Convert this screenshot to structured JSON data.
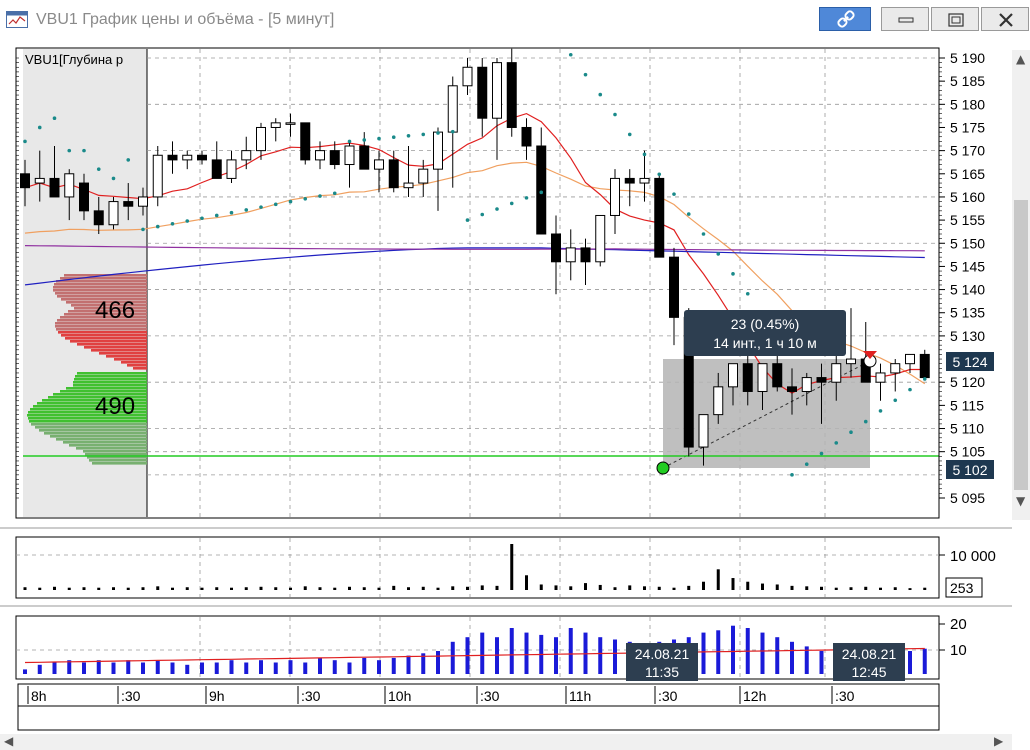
{
  "window": {
    "title": "VBU1 График цены и объёма - [5 минут]",
    "icon": "chart-window-icon",
    "buttons": {
      "link": "link-icon",
      "minimize": "minimize-icon",
      "maximize": "maximize-icon",
      "close": "close-icon"
    }
  },
  "price_panel": {
    "instrument_label": "VBU1[Глубина р",
    "price_ticks": [
      "5 190",
      "5 185",
      "5 180",
      "5 175",
      "5 170",
      "5 165",
      "5 160",
      "5 155",
      "5 150",
      "5 145",
      "5 140",
      "5 135",
      "5 130",
      "5 125",
      "5 120",
      "5 115",
      "5 110",
      "5 105",
      "5 100",
      "5 095"
    ],
    "last_price_tag": "5 124",
    "line_price_tag": "5 102",
    "profile_sell_label": "466",
    "profile_buy_label": "490",
    "tooltip_line1": "23 (0.45%)",
    "tooltip_line2": "14 инт., 1 ч 10 м",
    "colors": {
      "up": "#ffffff",
      "down": "#000000",
      "ma_fast": "#e02020",
      "ma_slow": "#f0a060",
      "ma_blue": "#2020c0",
      "ma_purple": "#9030a0",
      "parabolic": "#1a8a8a",
      "level_line": "#22cc22"
    }
  },
  "volume_panel": {
    "tick_label": "10 000",
    "current_value": "253"
  },
  "indicator_panel": {
    "tick_labels": [
      "20",
      "10"
    ],
    "cursor_left_date": "24.08.21",
    "cursor_left_time": "11:35",
    "cursor_right_date": "24.08.21",
    "cursor_right_time": "12:45"
  },
  "time_axis": {
    "labels": [
      "8h",
      ":30",
      "9h",
      ":30",
      "10h",
      ":30",
      "11h",
      ":30",
      "12h",
      ":30"
    ]
  },
  "chart_data": {
    "type": "candlestick",
    "price_axis": {
      "min": 5095,
      "max": 5190
    },
    "candles": [
      [
        5165,
        5168,
        5158,
        5162
      ],
      [
        5163,
        5170,
        5159,
        5164
      ],
      [
        5164,
        5171,
        5160,
        5160
      ],
      [
        5160,
        5166,
        5155,
        5165
      ],
      [
        5163,
        5165,
        5155,
        5157
      ],
      [
        5157,
        5160,
        5152,
        5154
      ],
      [
        5154,
        5160,
        5153,
        5159
      ],
      [
        5159,
        5163,
        5155,
        5158
      ],
      [
        5158,
        5162,
        5156,
        5160
      ],
      [
        5160,
        5171,
        5158,
        5169
      ],
      [
        5169,
        5172,
        5165,
        5168
      ],
      [
        5168,
        5170,
        5166,
        5169
      ],
      [
        5169,
        5170,
        5167,
        5168
      ],
      [
        5168,
        5172,
        5164,
        5164
      ],
      [
        5164,
        5170,
        5163,
        5168
      ],
      [
        5168,
        5173,
        5166,
        5170
      ],
      [
        5170,
        5176,
        5168,
        5175
      ],
      [
        5175,
        5177,
        5172,
        5176
      ],
      [
        5176,
        5178,
        5173,
        5176
      ],
      [
        5176,
        5176,
        5167,
        5168
      ],
      [
        5168,
        5172,
        5166,
        5170
      ],
      [
        5170,
        5172,
        5166,
        5167
      ],
      [
        5167,
        5172,
        5162,
        5171
      ],
      [
        5171,
        5174,
        5166,
        5166
      ],
      [
        5166,
        5170,
        5161,
        5168
      ],
      [
        5168,
        5170,
        5161,
        5162
      ],
      [
        5162,
        5171,
        5160,
        5163
      ],
      [
        5163,
        5168,
        5160,
        5166
      ],
      [
        5166,
        5175,
        5157,
        5174
      ],
      [
        5174,
        5186,
        5162,
        5184
      ],
      [
        5184,
        5190,
        5182,
        5188
      ],
      [
        5188,
        5190,
        5173,
        5177
      ],
      [
        5177,
        5190,
        5168,
        5189
      ],
      [
        5189,
        5192,
        5173,
        5175
      ],
      [
        5175,
        5177,
        5168,
        5171
      ],
      [
        5171,
        5175,
        5152,
        5152
      ],
      [
        5152,
        5156,
        5139,
        5146
      ],
      [
        5146,
        5153,
        5142,
        5149
      ],
      [
        5149,
        5151,
        5141,
        5146
      ],
      [
        5146,
        5153,
        5145,
        5156
      ],
      [
        5156,
        5166,
        5152,
        5164
      ],
      [
        5164,
        5166,
        5158,
        5163
      ],
      [
        5163,
        5170,
        5159,
        5164
      ],
      [
        5164,
        5165,
        5148,
        5147
      ],
      [
        5147,
        5149,
        5128,
        5134
      ],
      [
        5134,
        5136,
        5104,
        5106
      ],
      [
        5106,
        5112,
        5102,
        5113
      ],
      [
        5113,
        5122,
        5111,
        5119
      ],
      [
        5119,
        5124,
        5115,
        5124
      ],
      [
        5124,
        5128,
        5115,
        5118
      ],
      [
        5118,
        5124,
        5114,
        5124
      ],
      [
        5124,
        5126,
        5118,
        5119
      ],
      [
        5119,
        5123,
        5113,
        5118
      ],
      [
        5118,
        5122,
        5115,
        5121
      ],
      [
        5121,
        5124,
        5111,
        5120
      ],
      [
        5120,
        5126,
        5116,
        5124
      ],
      [
        5124,
        5136,
        5121,
        5125
      ],
      [
        5125,
        5133,
        5120,
        5120
      ],
      [
        5120,
        5124,
        5116,
        5122
      ],
      [
        5122,
        5125,
        5118,
        5124
      ],
      [
        5124,
        5126,
        5122,
        5126
      ],
      [
        5126,
        5127,
        5121,
        5121
      ]
    ],
    "volume": [
      6,
      5,
      7,
      5,
      6,
      5,
      6,
      5,
      6,
      8,
      5,
      6,
      5,
      6,
      5,
      6,
      7,
      6,
      5,
      8,
      6,
      5,
      7,
      6,
      5,
      9,
      6,
      7,
      5,
      8,
      7,
      10,
      9,
      100,
      32,
      12,
      10,
      8,
      15,
      11,
      6,
      10,
      8,
      7,
      5,
      9,
      18,
      45,
      26,
      18,
      14,
      12,
      9,
      8,
      7,
      5,
      6,
      7,
      5,
      6,
      4,
      5
    ],
    "indicator": [
      2,
      4,
      5,
      6,
      5,
      6,
      5,
      6,
      5,
      6,
      5,
      4,
      5,
      5,
      6,
      5,
      6,
      5,
      6,
      5,
      7,
      6,
      5,
      7,
      6,
      7,
      8,
      9,
      10,
      14,
      16,
      18,
      16,
      20,
      18,
      17,
      16,
      20,
      18,
      16,
      15,
      14,
      12,
      14,
      15,
      16,
      18,
      19,
      21,
      20,
      18,
      16,
      14,
      12,
      10,
      11,
      10,
      9,
      10,
      9,
      10,
      11
    ]
  }
}
